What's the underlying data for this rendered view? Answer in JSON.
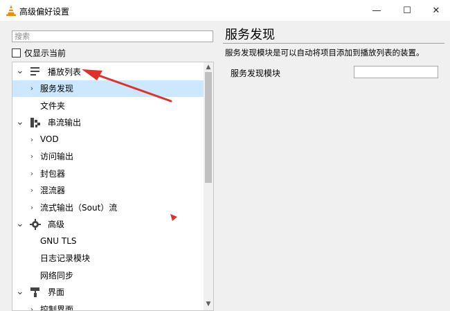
{
  "window": {
    "title": "高级偏好设置",
    "min_glyph": "—",
    "max_glyph": "☐",
    "close_glyph": "✕"
  },
  "search": {
    "placeholder": "搜索"
  },
  "filter": {
    "show_current_label": "仅显示当前"
  },
  "tree": {
    "items": [
      {
        "label": "播放列表",
        "level": 0,
        "expanded": true,
        "icon": "playlist-icon"
      },
      {
        "label": "服务发现",
        "level": 1,
        "selected": true,
        "has_children": true
      },
      {
        "label": "文件夹",
        "level": 1
      },
      {
        "label": "串流输出",
        "level": 0,
        "expanded": true,
        "icon": "stream-output-icon"
      },
      {
        "label": "VOD",
        "level": 1,
        "has_children": true
      },
      {
        "label": "访问输出",
        "level": 1,
        "has_children": true
      },
      {
        "label": "封包器",
        "level": 1,
        "has_children": true
      },
      {
        "label": "混流器",
        "level": 1,
        "has_children": true
      },
      {
        "label": "流式输出（Sout）流",
        "level": 1,
        "has_children": true
      },
      {
        "label": "高级",
        "level": 0,
        "expanded": true,
        "icon": "gear-icon"
      },
      {
        "label": "GNU TLS",
        "level": 1
      },
      {
        "label": "日志记录模块",
        "level": 1
      },
      {
        "label": "网络同步",
        "level": 1
      },
      {
        "label": "界面",
        "level": 0,
        "expanded": true,
        "icon": "paint-roller-icon"
      },
      {
        "label": "控制界面",
        "level": 1,
        "has_children": true
      }
    ]
  },
  "panel": {
    "title": "服务发现",
    "description": "服务发现模块是可以自动将项目添加到播放列表的装置。",
    "field_label": "服务发现模块",
    "field_value": ""
  },
  "colors": {
    "selection": "#cce8ff",
    "annotation_arrow": "#e0302a",
    "vlc_orange": "#f28c00"
  }
}
